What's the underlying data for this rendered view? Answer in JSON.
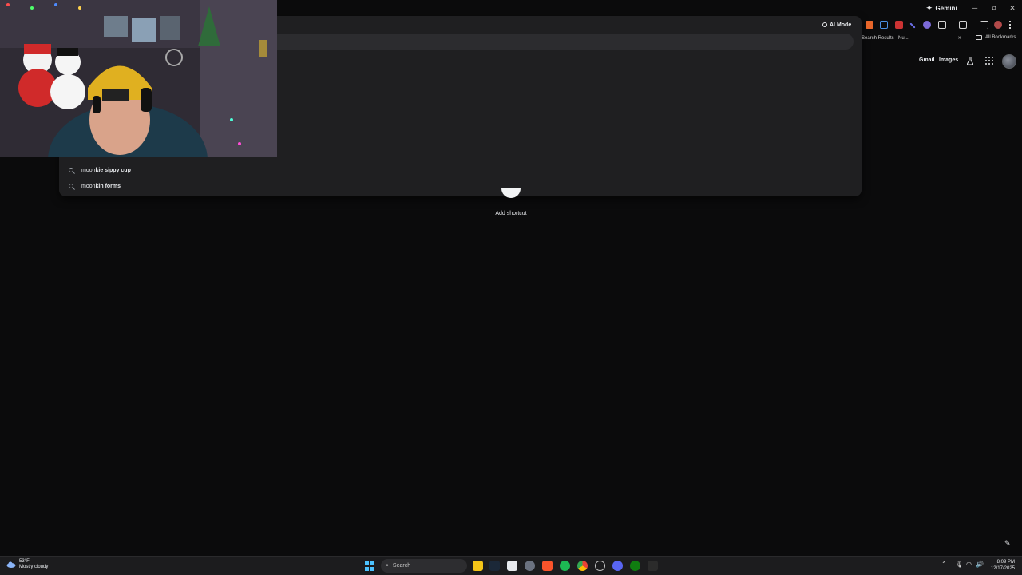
{
  "titlebar": {
    "gemini_label": "Gemini",
    "minimize_glyph": "─",
    "restore_glyph": "⧉",
    "close_glyph": "✕"
  },
  "omnibox": {
    "suggestions": [
      {
        "typed": "moon",
        "completion": "kie sippy cup"
      },
      {
        "typed": "moon",
        "completion": "kin forms"
      }
    ]
  },
  "toolbar": {
    "ai_mode_label": "AI Mode",
    "extension_icons": [
      "fox-extension-icon",
      "audio-extension-icon",
      "shield-extension-icon",
      "pen-extension-icon",
      "leaf-extension-icon",
      "puzzle-extensions-icon",
      "tab-search-icon",
      "media-cast-icon",
      "profile-icon",
      "more-menu-icon"
    ]
  },
  "bookmarks": {
    "item": "Search Results - Nu...",
    "overflow_glyph": "»",
    "all_bookmarks_label": "All Bookmarks"
  },
  "ntp": {
    "gmail_label": "Gmail",
    "images_label": "Images",
    "add_shortcut_label": "Add shortcut"
  },
  "taskbar": {
    "weather_temp": "53°F",
    "weather_desc": "Mostly cloudy",
    "search_placeholder": "Search",
    "time": "8:09 PM",
    "date": "12/17/2025",
    "tray_up_glyph": "⌃"
  },
  "colors": {
    "background": "#0b0b0c",
    "omnibox_bg": "#1f1f21",
    "accent_start": "#4cc2ff"
  }
}
